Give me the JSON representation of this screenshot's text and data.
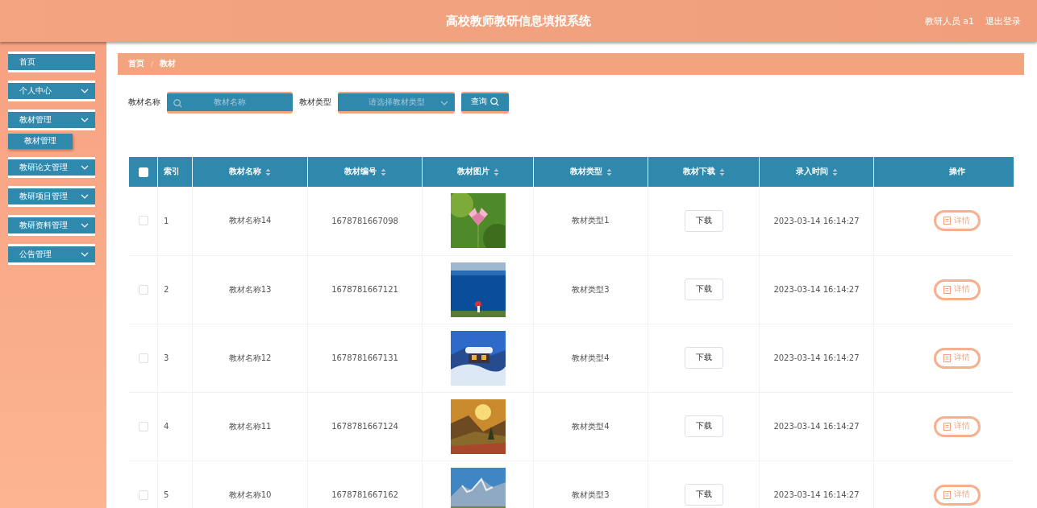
{
  "header": {
    "title": "高校教师教研信息填报系统",
    "user": "教研人员 a1",
    "logout": "退出登录"
  },
  "sidebar": {
    "items": [
      {
        "label": "首页",
        "has_arrow": false
      },
      {
        "label": "个人中心",
        "has_arrow": true
      },
      {
        "label": "教材管理",
        "has_arrow": true,
        "children": [
          {
            "label": "教材管理"
          }
        ]
      },
      {
        "label": "教研论文管理",
        "has_arrow": true
      },
      {
        "label": "教研项目管理",
        "has_arrow": true
      },
      {
        "label": "教研资料管理",
        "has_arrow": true
      },
      {
        "label": "公告管理",
        "has_arrow": true
      }
    ]
  },
  "breadcrumb": {
    "separator": "/",
    "items": [
      "首页",
      "教材"
    ]
  },
  "search": {
    "fields": [
      {
        "kind": "text",
        "label": "教材名称",
        "placeholder": "教材名称"
      },
      {
        "kind": "select",
        "label": "教材类型",
        "placeholder": "请选择教材类型"
      }
    ],
    "button": "查询"
  },
  "table": {
    "select_all": {
      "checked": false
    },
    "columns": [
      {
        "label": "索引",
        "sortable": false
      },
      {
        "label": "教材名称",
        "sortable": true
      },
      {
        "label": "教材编号",
        "sortable": true
      },
      {
        "label": "教材图片",
        "sortable": true
      },
      {
        "label": "教材类型",
        "sortable": true
      },
      {
        "label": "教材下载",
        "sortable": true
      },
      {
        "label": "录入时间",
        "sortable": true
      },
      {
        "label": "操作",
        "sortable": false
      }
    ],
    "rows": [
      {
        "checked": false,
        "index": "1",
        "name": "教材名称14",
        "code": "1678781667098",
        "type": "教材类型1",
        "download": "下载",
        "time": "2023-03-14 16:14:27",
        "action": "详情"
      },
      {
        "checked": false,
        "index": "2",
        "name": "教材名称13",
        "code": "1678781667121",
        "type": "教材类型3",
        "download": "下载",
        "time": "2023-03-14 16:14:27",
        "action": "详情"
      },
      {
        "checked": false,
        "index": "3",
        "name": "教材名称12",
        "code": "1678781667131",
        "type": "教材类型4",
        "download": "下载",
        "time": "2023-03-14 16:14:27",
        "action": "详情"
      },
      {
        "checked": false,
        "index": "4",
        "name": "教材名称11",
        "code": "1678781667124",
        "type": "教材类型4",
        "download": "下载",
        "time": "2023-03-14 16:14:27",
        "action": "详情"
      },
      {
        "checked": false,
        "index": "5",
        "name": "教材名称10",
        "code": "1678781667162",
        "type": "教材类型3",
        "download": "下载",
        "time": "2023-03-14 16:14:27",
        "action": "详情"
      }
    ]
  }
}
